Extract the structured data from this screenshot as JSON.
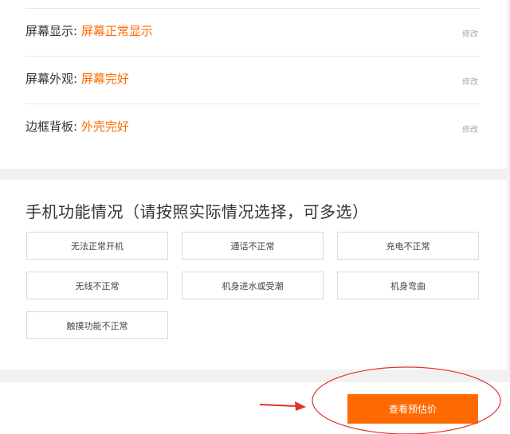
{
  "conditions": [
    {
      "label": "屏幕显示:",
      "value": "屏幕正常显示",
      "edit": "修改"
    },
    {
      "label": "屏幕外观:",
      "value": "屏幕完好",
      "edit": "修改"
    },
    {
      "label": "边框背板:",
      "value": "外壳完好",
      "edit": "修改"
    }
  ],
  "function_section": {
    "title": "手机功能情况（请按照实际情况选择，可多选）",
    "options": [
      "无法正常开机",
      "通话不正常",
      "充电不正常",
      "无线不正常",
      "机身进水或受潮",
      "机身弯曲",
      "触摸功能不正常"
    ]
  },
  "footer": {
    "estimate_label": "查看预估价"
  },
  "colors": {
    "accent": "#ff6a00",
    "annotation": "#e0322e"
  }
}
